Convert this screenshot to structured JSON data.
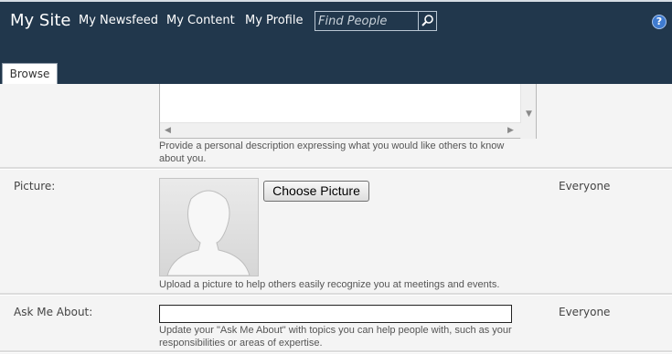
{
  "header": {
    "site_title": "My Site",
    "nav": [
      {
        "label": "My Newsfeed"
      },
      {
        "label": "My Content"
      },
      {
        "label": "My Profile"
      }
    ],
    "search": {
      "placeholder": "Find People",
      "value": ""
    },
    "help_label": "?"
  },
  "ribbon": {
    "tabs": [
      {
        "label": "Browse",
        "selected": true
      }
    ]
  },
  "form": {
    "about_me": {
      "help": "Provide a personal description expressing what you would like others to know about you."
    },
    "picture": {
      "label": "Picture:",
      "button_label": "Choose Picture",
      "help": "Upload a picture to help others easily recognize you at meetings and events.",
      "privacy": "Everyone"
    },
    "ask_me_about": {
      "label": "Ask Me About:",
      "value": "",
      "help": "Update your \"Ask Me About\" with topics you can help people with, such as your responsibilities or areas of expertise.",
      "privacy": "Everyone"
    }
  },
  "colors": {
    "header_bg": "#21374c",
    "help_icon": "#3f7bd0",
    "content_bg": "#f4f4f4"
  }
}
